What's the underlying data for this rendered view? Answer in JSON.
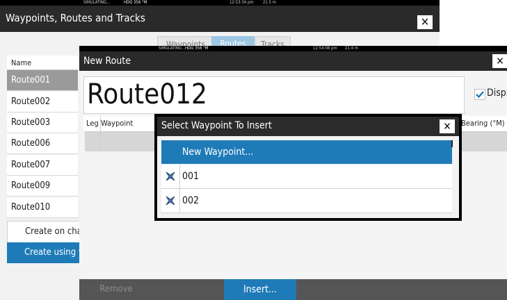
{
  "back_window": {
    "status": {
      "sim": "SIMULATING...",
      "hdg": "HDG 356 °M",
      "time": "12:53:34 pm",
      "depth": "21.5 m"
    },
    "title": "Waypoints, Routes and Tracks",
    "tabs": [
      "Waypoints",
      "Routes",
      "Tracks"
    ],
    "name_header": "Name",
    "routes": [
      "Route001",
      "Route002",
      "Route003",
      "Route006",
      "Route007",
      "Route009",
      "Route010"
    ],
    "create_buttons": [
      "Create on chart",
      "Create using waypoints"
    ]
  },
  "front_window": {
    "status": {
      "sim": "SIMULATING...",
      "hdg": "HDG 356 °M",
      "time": "12:54:08 pm",
      "depth": "21.4 m"
    },
    "title": "New Route",
    "route_name": "Route012",
    "display_label": "Display",
    "columns": {
      "leg": "Leg",
      "waypoint": "Waypoint",
      "bearing": "Bearing (°M)"
    },
    "buttons": {
      "remove": "Remove",
      "insert": "Insert..."
    }
  },
  "dialog": {
    "title": "Select Waypoint To Insert",
    "items": [
      "New Waypoint...",
      "001",
      "002"
    ]
  },
  "colors": {
    "accent": "#1f7bb8",
    "titlebar": "#2a2a2a"
  }
}
